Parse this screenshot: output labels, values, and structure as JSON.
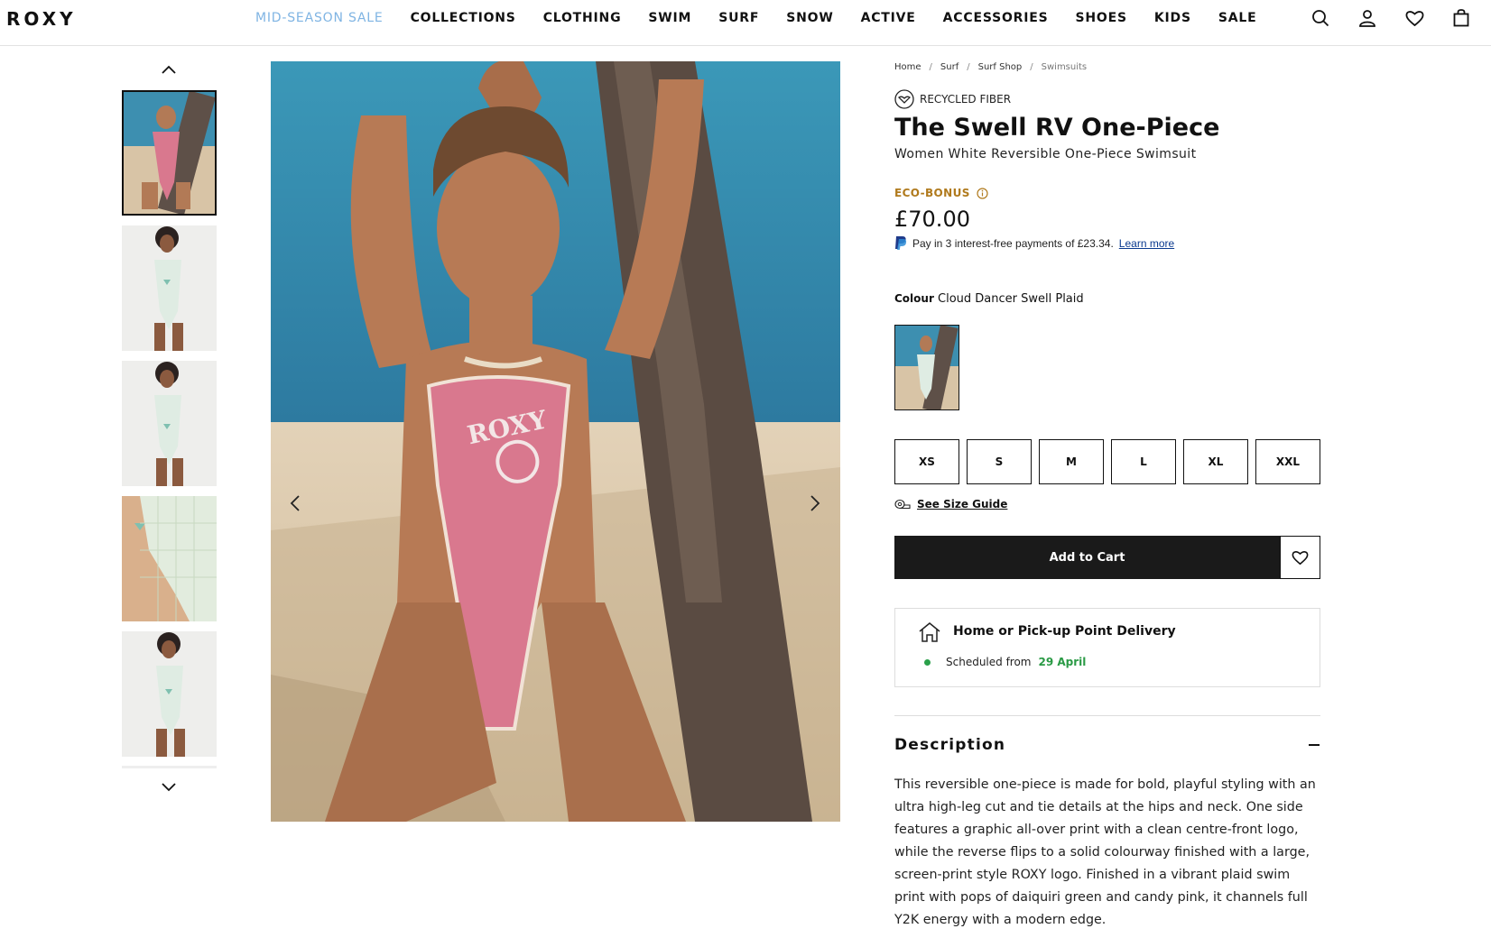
{
  "brand": {
    "logo": "ROXY"
  },
  "nav": {
    "items": [
      "MID-SEASON SALE",
      "COLLECTIONS",
      "CLOTHING",
      "SWIM",
      "SURF",
      "SNOW",
      "ACTIVE",
      "ACCESSORIES",
      "SHOES",
      "KIDS",
      "SALE"
    ],
    "highlight_color": "#7fb4e3"
  },
  "header_icons": [
    "search-icon",
    "account-icon",
    "wishlist-icon",
    "bag-icon"
  ],
  "breadcrumb": [
    "Home",
    "Surf",
    "Surf Shop",
    "Swimsuits"
  ],
  "product": {
    "eco_tag": "RECYCLED FIBER",
    "title": "The Swell RV One-Piece",
    "subtitle": "Women White Reversible One-Piece Swimsuit",
    "eco_bonus": "ECO-BONUS",
    "price": "£70.00",
    "paypal_text": "Pay in 3 interest-free payments of £23.34.",
    "paypal_link": "Learn more",
    "colour_label": "Colour",
    "colour_value": "Cloud Dancer Swell Plaid",
    "sizes": [
      "XS",
      "S",
      "M",
      "L",
      "XL",
      "XXL"
    ],
    "size_guide": "See Size Guide",
    "add_to_cart": "Add to Cart",
    "delivery_title": "Home or Pick-up Point Delivery",
    "delivery_sched": "Scheduled from",
    "delivery_date": "29 April",
    "description_title": "Description",
    "description": "This reversible one-piece is made for bold, playful styling with an ultra high-leg cut and tie details at the hips and neck. One side features a graphic all-over print with a clean centre-front logo, while the reverse flips to a solid colourway finished with a large, screen-print style ROXY logo. Finished in a vibrant plaid swim print with pops of daiquiri green and candy pink, it channels full Y2K energy with a modern edge."
  },
  "colors": {
    "accent_sale": "#7fb4e3",
    "eco_bonus": "#b07a1d",
    "delivery_green": "#2a9a45",
    "button_dark": "#1a1a1a",
    "swimsuit_pink": "#d9788e"
  }
}
